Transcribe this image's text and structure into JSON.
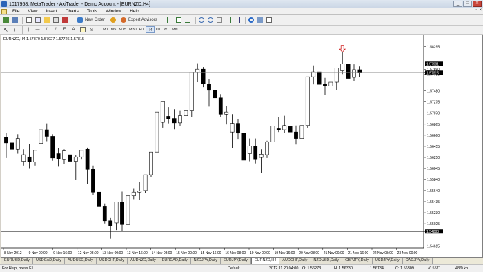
{
  "window": {
    "title": "1017958: MetaTrader - AxiTrader - Demo Account - [EURNZD,H4]"
  },
  "menu": [
    "File",
    "View",
    "Insert",
    "Charts",
    "Tools",
    "Window",
    "Help"
  ],
  "toolbar": {
    "new_order": "New Order",
    "expert_advisors": "Expert Advisors"
  },
  "timeframes": [
    "M1",
    "M5",
    "M15",
    "M30",
    "H1",
    "H4",
    "D1",
    "W1",
    "MN"
  ],
  "active_timeframe": "H4",
  "chart": {
    "symbol_info": "EURNZD,H4  1.57870 1.57927 1.57726 1.57815",
    "price_labels": [
      "1.58295",
      "1.57981",
      "1.57815",
      "1.57890",
      "1.57785",
      "1.57480",
      "1.57275",
      "1.57070",
      "1.56865",
      "1.56660",
      "1.56455",
      "1.56250",
      "1.56045",
      "1.55840",
      "1.55640",
      "1.55435",
      "1.55230",
      "1.55025",
      "1.54883",
      "1.54615"
    ],
    "time_labels": [
      "8 Nov 2012",
      "9 Nov 00:00",
      "9 Nov 16:00",
      "12 Nov 08:00",
      "13 Nov 00:00",
      "13 Nov 16:00",
      "14 Nov 08:00",
      "15 Nov 00:00",
      "15 Nov 16:00",
      "16 Nov 08:00",
      "19 Nov 00:00",
      "19 Nov 16:00",
      "20 Nov 08:00",
      "21 Nov 00:00",
      "21 Nov 16:00",
      "22 Nov 08:00",
      "23 Nov 00:00"
    ]
  },
  "chart_data": {
    "type": "candlestick",
    "ylim": [
      1.5458,
      1.5838
    ],
    "candles": [
      {
        "o": 1.5662,
        "h": 1.5671,
        "c": 1.5652,
        "l": 1.5624
      },
      {
        "o": 1.5652,
        "h": 1.5667,
        "c": 1.564,
        "l": 1.5615
      },
      {
        "o": 1.564,
        "h": 1.5668,
        "c": 1.566,
        "l": 1.5632
      },
      {
        "o": 1.5618,
        "h": 1.564,
        "c": 1.563,
        "l": 1.561
      },
      {
        "o": 1.5626,
        "h": 1.565,
        "c": 1.5617,
        "l": 1.5604
      },
      {
        "o": 1.5617,
        "h": 1.5625,
        "c": 1.5638,
        "l": 1.561
      },
      {
        "o": 1.5651,
        "h": 1.5677,
        "c": 1.5676,
        "l": 1.564
      },
      {
        "o": 1.5676,
        "h": 1.5688,
        "c": 1.5664,
        "l": 1.5655
      },
      {
        "o": 1.5664,
        "h": 1.5668,
        "c": 1.5624,
        "l": 1.5619
      },
      {
        "o": 1.5632,
        "h": 1.5642,
        "c": 1.5622,
        "l": 1.5608
      },
      {
        "o": 1.5621,
        "h": 1.564,
        "c": 1.5637,
        "l": 1.5613
      },
      {
        "o": 1.563,
        "h": 1.5645,
        "c": 1.5618,
        "l": 1.56
      },
      {
        "o": 1.5618,
        "h": 1.563,
        "c": 1.5626,
        "l": 1.5583
      },
      {
        "o": 1.5626,
        "h": 1.5634,
        "c": 1.5638,
        "l": 1.5621
      },
      {
        "o": 1.564,
        "h": 1.5643,
        "c": 1.5603,
        "l": 1.5576
      },
      {
        "o": 1.5603,
        "h": 1.561,
        "c": 1.5561,
        "l": 1.5555
      },
      {
        "o": 1.5561,
        "h": 1.5575,
        "c": 1.5534,
        "l": 1.5528
      },
      {
        "o": 1.5534,
        "h": 1.554,
        "c": 1.5508,
        "l": 1.5503
      },
      {
        "o": 1.5508,
        "h": 1.5513,
        "c": 1.5499,
        "l": 1.5475
      },
      {
        "o": 1.5504,
        "h": 1.552,
        "c": 1.5543,
        "l": 1.5491
      },
      {
        "o": 1.5543,
        "h": 1.5562,
        "c": 1.5501,
        "l": 1.5488
      },
      {
        "o": 1.5501,
        "h": 1.5518,
        "c": 1.5554,
        "l": 1.5497
      },
      {
        "o": 1.5554,
        "h": 1.5567,
        "c": 1.5561,
        "l": 1.5548
      },
      {
        "o": 1.5561,
        "h": 1.558,
        "c": 1.5563,
        "l": 1.5547
      },
      {
        "o": 1.5564,
        "h": 1.5588,
        "c": 1.5593,
        "l": 1.5559
      },
      {
        "o": 1.5593,
        "h": 1.5634,
        "c": 1.5635,
        "l": 1.5589
      },
      {
        "o": 1.5635,
        "h": 1.5687,
        "c": 1.5709,
        "l": 1.5626
      },
      {
        "o": 1.569,
        "h": 1.5714,
        "c": 1.5728,
        "l": 1.568
      },
      {
        "o": 1.5701,
        "h": 1.5718,
        "c": 1.5696,
        "l": 1.5688
      },
      {
        "o": 1.5697,
        "h": 1.5714,
        "c": 1.5689,
        "l": 1.5677
      },
      {
        "o": 1.5689,
        "h": 1.5711,
        "c": 1.5702,
        "l": 1.5683
      },
      {
        "o": 1.5702,
        "h": 1.5726,
        "c": 1.5711,
        "l": 1.5683
      },
      {
        "o": 1.5711,
        "h": 1.5745,
        "c": 1.5782,
        "l": 1.5699
      },
      {
        "o": 1.5782,
        "h": 1.5799,
        "c": 1.5788,
        "l": 1.5764
      },
      {
        "o": 1.5788,
        "h": 1.5792,
        "c": 1.5761,
        "l": 1.5755
      },
      {
        "o": 1.5761,
        "h": 1.577,
        "c": 1.5749,
        "l": 1.5719
      },
      {
        "o": 1.5749,
        "h": 1.5761,
        "c": 1.5735,
        "l": 1.5724
      },
      {
        "o": 1.5735,
        "h": 1.5742,
        "c": 1.5705,
        "l": 1.57
      },
      {
        "o": 1.5705,
        "h": 1.572,
        "c": 1.5709,
        "l": 1.5686
      },
      {
        "o": 1.5672,
        "h": 1.5705,
        "c": 1.5688,
        "l": 1.5642
      },
      {
        "o": 1.5688,
        "h": 1.5696,
        "c": 1.567,
        "l": 1.5658
      },
      {
        "o": 1.567,
        "h": 1.5682,
        "c": 1.562,
        "l": 1.5605
      },
      {
        "o": 1.5632,
        "h": 1.566,
        "c": 1.5646,
        "l": 1.5618
      },
      {
        "o": 1.5646,
        "h": 1.566,
        "c": 1.5621,
        "l": 1.5614
      },
      {
        "o": 1.5625,
        "h": 1.564,
        "c": 1.5631,
        "l": 1.5597
      },
      {
        "o": 1.563,
        "h": 1.5656,
        "c": 1.5654,
        "l": 1.5624
      },
      {
        "o": 1.5654,
        "h": 1.5685,
        "c": 1.5683,
        "l": 1.5648
      },
      {
        "o": 1.5678,
        "h": 1.57,
        "c": 1.5676,
        "l": 1.5672
      },
      {
        "o": 1.5676,
        "h": 1.5702,
        "c": 1.5684,
        "l": 1.567
      },
      {
        "o": 1.5682,
        "h": 1.5696,
        "c": 1.5672,
        "l": 1.5653
      },
      {
        "o": 1.5672,
        "h": 1.5684,
        "c": 1.566,
        "l": 1.5649
      },
      {
        "o": 1.566,
        "h": 1.567,
        "c": 1.5684,
        "l": 1.5652
      },
      {
        "o": 1.5684,
        "h": 1.5695,
        "c": 1.5774,
        "l": 1.568
      },
      {
        "o": 1.5774,
        "h": 1.5795,
        "c": 1.5783,
        "l": 1.576
      },
      {
        "o": 1.5783,
        "h": 1.579,
        "c": 1.576,
        "l": 1.5748
      },
      {
        "o": 1.576,
        "h": 1.5772,
        "c": 1.5757,
        "l": 1.574
      },
      {
        "o": 1.5757,
        "h": 1.5777,
        "c": 1.5764,
        "l": 1.5745
      },
      {
        "o": 1.5764,
        "h": 1.579,
        "c": 1.579,
        "l": 1.575
      },
      {
        "o": 1.5785,
        "h": 1.5819,
        "c": 1.5798,
        "l": 1.5779
      },
      {
        "o": 1.5798,
        "h": 1.581,
        "c": 1.5771,
        "l": 1.5769
      },
      {
        "o": 1.5773,
        "h": 1.5797,
        "c": 1.5787,
        "l": 1.5766
      },
      {
        "o": 1.5787,
        "h": 1.5793,
        "c": 1.5781,
        "l": 1.5773
      }
    ]
  },
  "tabs": [
    "EURUSD,Daily",
    "USDCAD,Daily",
    "AUDUSD,Daily",
    "USDCHF,Daily",
    "AUDNZD,Daily",
    "EURCAD,Daily",
    "NZDJPY,Daily",
    "EURJPY,Daily",
    "EURNZD,H4",
    "AUDCHF,Daily",
    "NZDUSD,Daily",
    "GBPJPY,Daily",
    "USDJPY,Daily",
    "CADJPY,Daily"
  ],
  "active_tab": "EURNZD,H4",
  "status": {
    "help": "For Help, press F1",
    "profile": "Default",
    "datetime": "2012.11.20 04:00",
    "open": "O: 1.56273",
    "high": "H: 1.56330",
    "low": "L: 1.56134",
    "close": "C: 1.56309",
    "volume": "V: 5571",
    "traffic": "48/0 kb"
  },
  "colors": {
    "bull": "#ffffff",
    "bear": "#000000",
    "grid": "#c0c0c0",
    "titlebar": "#c9d5e4"
  }
}
